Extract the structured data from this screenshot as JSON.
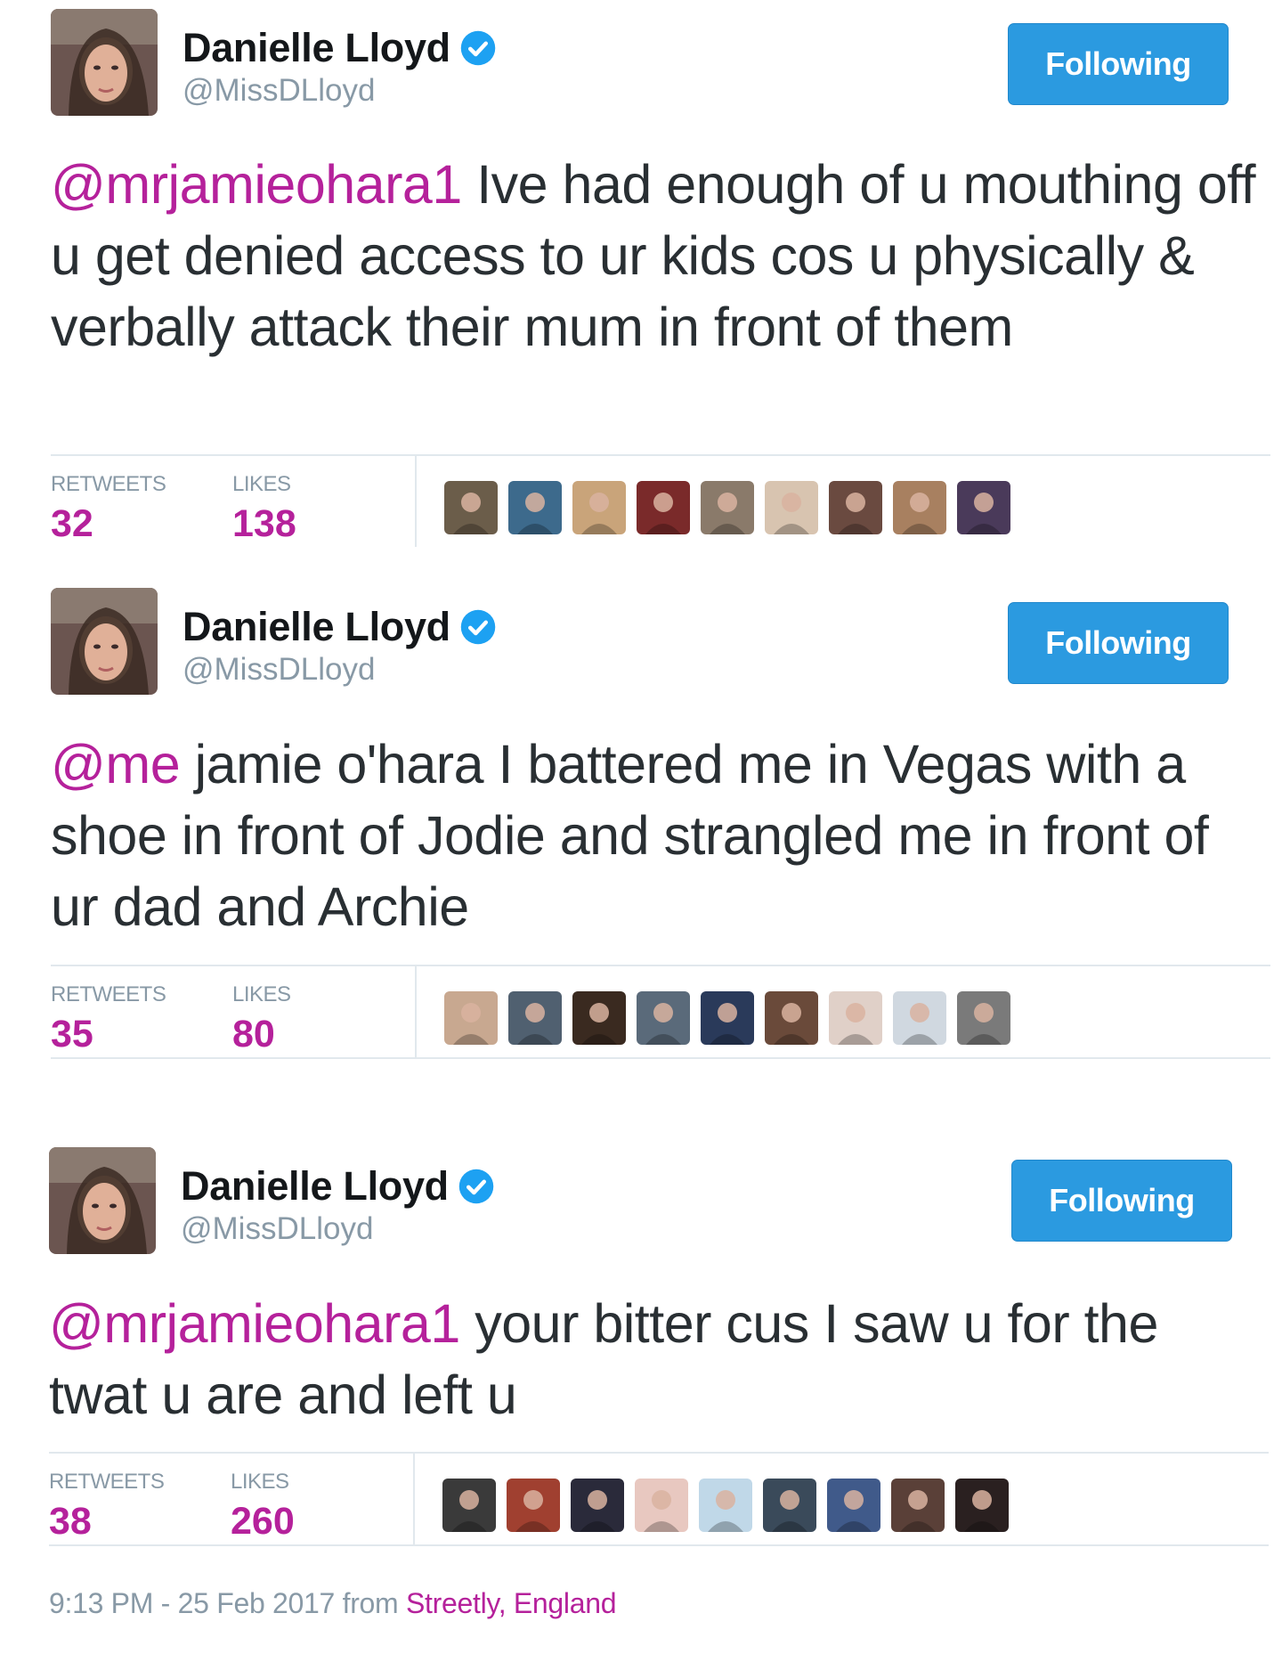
{
  "tweets": [
    {
      "display_name": "Danielle Lloyd",
      "handle": "@MissDLloyd",
      "follow_label": "Following",
      "mention": "@mrjamieohara1",
      "text": " Ive had enough of u mouthing off u get denied access to ur kids cos u physically & verbally attack their mum in front of them",
      "retweets_label": "RETWEETS",
      "retweets": "32",
      "likes_label": "LIKES",
      "likes": "138",
      "liker_colors": [
        "#6b5d4a",
        "#3d6a8c",
        "#c9a47a",
        "#7a2a2a",
        "#8a7a6a",
        "#d8c4b0",
        "#6a4a40",
        "#a88060",
        "#4a3a5a"
      ]
    },
    {
      "display_name": "Danielle Lloyd",
      "handle": "@MissDLloyd",
      "follow_label": "Following",
      "mention": "@me",
      "text": " jamie o'hara I battered me in Vegas with a shoe in front of Jodie and strangled me in front of ur dad and Archie",
      "retweets_label": "RETWEETS",
      "retweets": "35",
      "likes_label": "LIKES",
      "likes": "80",
      "liker_colors": [
        "#c8a890",
        "#506070",
        "#3a2a20",
        "#5a6a7a",
        "#2a3a5a",
        "#6a4a3a",
        "#e0d0c8",
        "#d0d8e0",
        "#7a7a7a"
      ]
    },
    {
      "display_name": "Danielle Lloyd",
      "handle": "@MissDLloyd",
      "follow_label": "Following",
      "mention": "@mrjamieohara1",
      "text": " your bitter cus I saw u for the twat u are and left u",
      "retweets_label": "RETWEETS",
      "retweets": "38",
      "likes_label": "LIKES",
      "likes": "260",
      "liker_colors": [
        "#3a3a3a",
        "#a04030",
        "#2a2a3a",
        "#e8c8c0",
        "#c0d8e8",
        "#3a4a5a",
        "#405a8a",
        "#5a4038",
        "#2a2020"
      ]
    }
  ],
  "footer": {
    "time": "9:13 PM - 25 Feb 2017 from ",
    "location": "Streetly, England"
  },
  "colors": {
    "accent_link": "#b5219b",
    "follow_button": "#2b9ae0",
    "verified_badge": "#1da1f2",
    "muted_text": "#8899a6"
  }
}
